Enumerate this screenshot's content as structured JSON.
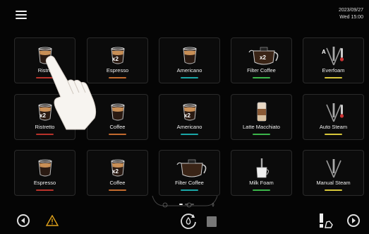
{
  "header": {
    "date": "2023/09/27",
    "day_time": "Wed  15:00"
  },
  "tiles": [
    {
      "label": "Ristretto",
      "display": "Ristre",
      "accent": "#b8322a",
      "icon": "espresso-cup-icon"
    },
    {
      "label": "Espresso",
      "display": "Espresso",
      "accent": "#c26a2e",
      "icon": "double-espresso-cup-icon"
    },
    {
      "label": "Americano",
      "display": "Americano",
      "accent": "#1aa6a6",
      "icon": "americano-cup-icon"
    },
    {
      "label": "Filter Coffee",
      "display": "Filter Coffee",
      "accent": "#3bb54a",
      "icon": "double-filter-coffee-pot-icon"
    },
    {
      "label": "Everfoam",
      "display": "Everfoam",
      "accent": "#d7c63a",
      "icon": "steam-wand-thermometer-icon"
    },
    {
      "label": "Ristretto",
      "display": "Ristretto",
      "accent": "#b8322a",
      "icon": "double-ristretto-cup-icon"
    },
    {
      "label": "Coffee",
      "display": "Coffee",
      "accent": "#c26a2e",
      "icon": "coffee-cup-icon"
    },
    {
      "label": "Americano",
      "display": "Americano",
      "accent": "#1aa6a6",
      "icon": "double-americano-cup-icon"
    },
    {
      "label": "Latte Macchiato",
      "display": "Latte Macchiato",
      "accent": "#3bb54a",
      "icon": "latte-glass-icon"
    },
    {
      "label": "Auto Steam",
      "display": "Auto Steam",
      "accent": "#d7c63a",
      "icon": "steam-wand-thermometer-icon"
    },
    {
      "label": "Espresso",
      "display": "Espresso",
      "accent": "#b8322a",
      "icon": "espresso-cup-icon"
    },
    {
      "label": "Coffee",
      "display": "Coffee",
      "accent": "#c26a2e",
      "icon": "double-coffee-cup-icon"
    },
    {
      "label": "Filter Coffee",
      "display": "Filter Coffee",
      "accent": "#1aa6a6",
      "icon": "filter-coffee-pot-icon"
    },
    {
      "label": "Milk Foam",
      "display": "Milk Foam",
      "accent": "#3bb54a",
      "icon": "milk-foam-icon"
    },
    {
      "label": "Manual Steam",
      "display": "Manual Steam",
      "accent": "#d7c63a",
      "icon": "steam-wand-icon"
    }
  ],
  "badges": {
    "double": "x2",
    "foam": "A"
  },
  "pager": {
    "pages": 3,
    "active": 1
  }
}
